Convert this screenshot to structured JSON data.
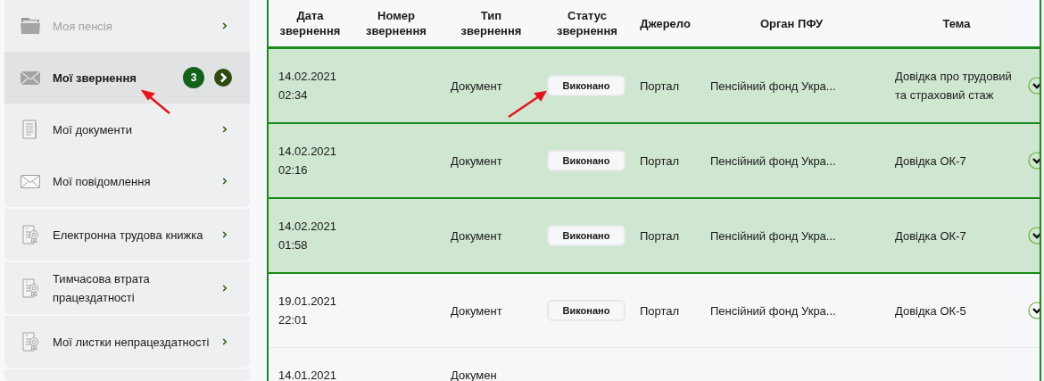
{
  "sidebar": {
    "groups": [
      {
        "items": [
          {
            "label": "Моя пенсія",
            "selected": false,
            "disabled": true
          },
          {
            "label": "Мої звернення",
            "selected": true,
            "disabled": false,
            "badge": "3"
          },
          {
            "label": "Мої документи",
            "selected": false,
            "disabled": false
          },
          {
            "label": "Мої повідомлення",
            "selected": false,
            "disabled": false
          }
        ]
      },
      {
        "items": [
          {
            "label": "Електронна трудова книжка",
            "selected": false,
            "disabled": false
          }
        ]
      },
      {
        "items": [
          {
            "label": "Тимчасова втрата працездатності",
            "selected": false,
            "disabled": false
          }
        ]
      },
      {
        "items": [
          {
            "label": "Мої листки непрацездатності",
            "selected": false,
            "disabled": false
          }
        ]
      }
    ]
  },
  "table": {
    "columns": [
      "Дата звернення",
      "Номер звернення",
      "Тип звернення",
      "Статус звернення",
      "Джерело",
      "Орган ПФУ",
      "Тема"
    ],
    "rows": [
      {
        "highlighted": true,
        "date": "14.02.2021",
        "time": "02:34",
        "type": "Документ",
        "status": "Виконано",
        "source": "Портал",
        "office": "Пенсійний фонд Укра...",
        "topic": "Довідка про трудовий та страховий стаж"
      },
      {
        "highlighted": true,
        "date": "14.02.2021",
        "time": "02:16",
        "type": "Документ",
        "status": "Виконано",
        "source": "Портал",
        "office": "Пенсійний фонд Укра...",
        "topic": "Довідка ОК-7"
      },
      {
        "highlighted": true,
        "date": "14.02.2021",
        "time": "01:58",
        "type": "Документ",
        "status": "Виконано",
        "source": "Портал",
        "office": "Пенсійний фонд Укра...",
        "topic": "Довідка ОК-7"
      },
      {
        "highlighted": false,
        "date": "19.01.2021",
        "time": "22:01",
        "type": "Документ",
        "status": "Виконано",
        "source": "Портал",
        "office": "Пенсійний фонд Укра...",
        "topic": "Довідка ОК-5"
      },
      {
        "highlighted": false,
        "date": "14.01.2021",
        "type": "Докумен"
      }
    ]
  }
}
